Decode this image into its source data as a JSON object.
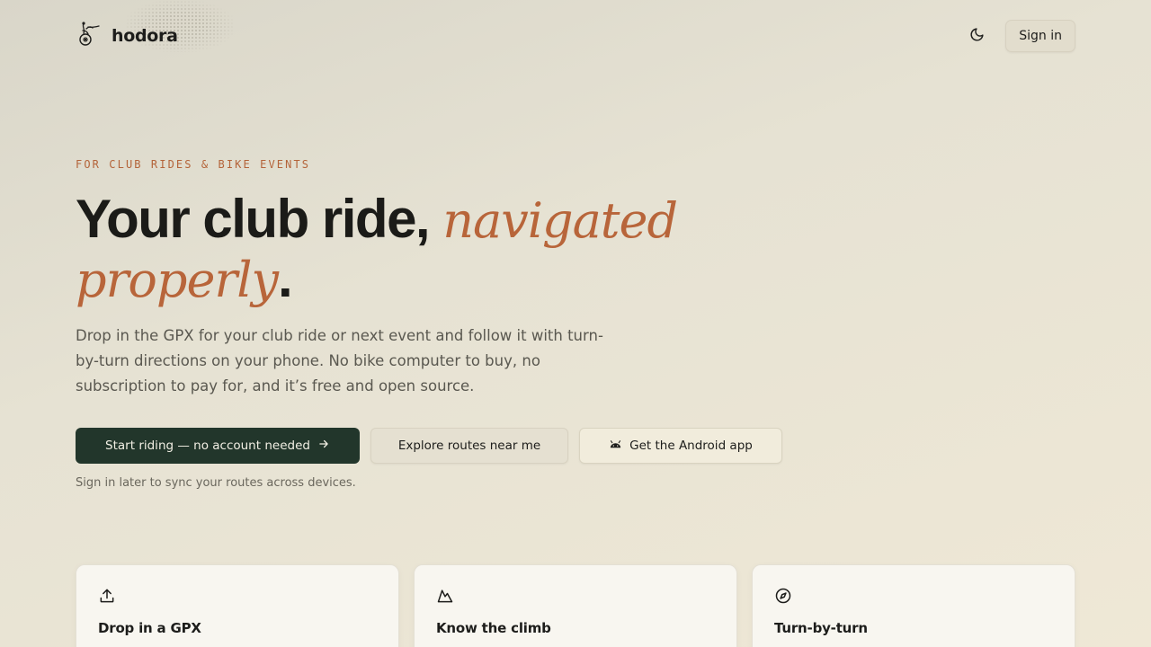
{
  "brand": {
    "name": "hodora",
    "logo_icon": "cyclist-logo-icon"
  },
  "header": {
    "theme_icon": "moon-icon",
    "signin_label": "Sign in"
  },
  "hero": {
    "eyebrow": "FOR CLUB RIDES & BIKE EVENTS",
    "title_part1": "Your club ride, ",
    "title_accent1": "navigated",
    "title_accent2": "properly",
    "title_end": ".",
    "lede": "Drop in the GPX for your club ride or next event and follow it with turn-by-turn directions on your phone. No bike computer to buy, no subscription to pay for, and it’s free and open source."
  },
  "ctas": {
    "primary_label": "Start riding — no account needed",
    "primary_icon": "arrow-right-icon",
    "secondary_label": "Explore routes near me",
    "tertiary_label": "Get the Android app",
    "tertiary_icon": "android-icon"
  },
  "hint": "Sign in later to sync your routes across devices.",
  "features": [
    {
      "title": "Drop in a GPX",
      "icon": "upload-icon"
    },
    {
      "title": "Know the climb",
      "icon": "mountain-icon"
    },
    {
      "title": "Turn-by-turn",
      "icon": "compass-icon"
    }
  ],
  "colors": {
    "accent": "#b8653a",
    "primary": "#22362b",
    "background": "#e6e2d3"
  }
}
